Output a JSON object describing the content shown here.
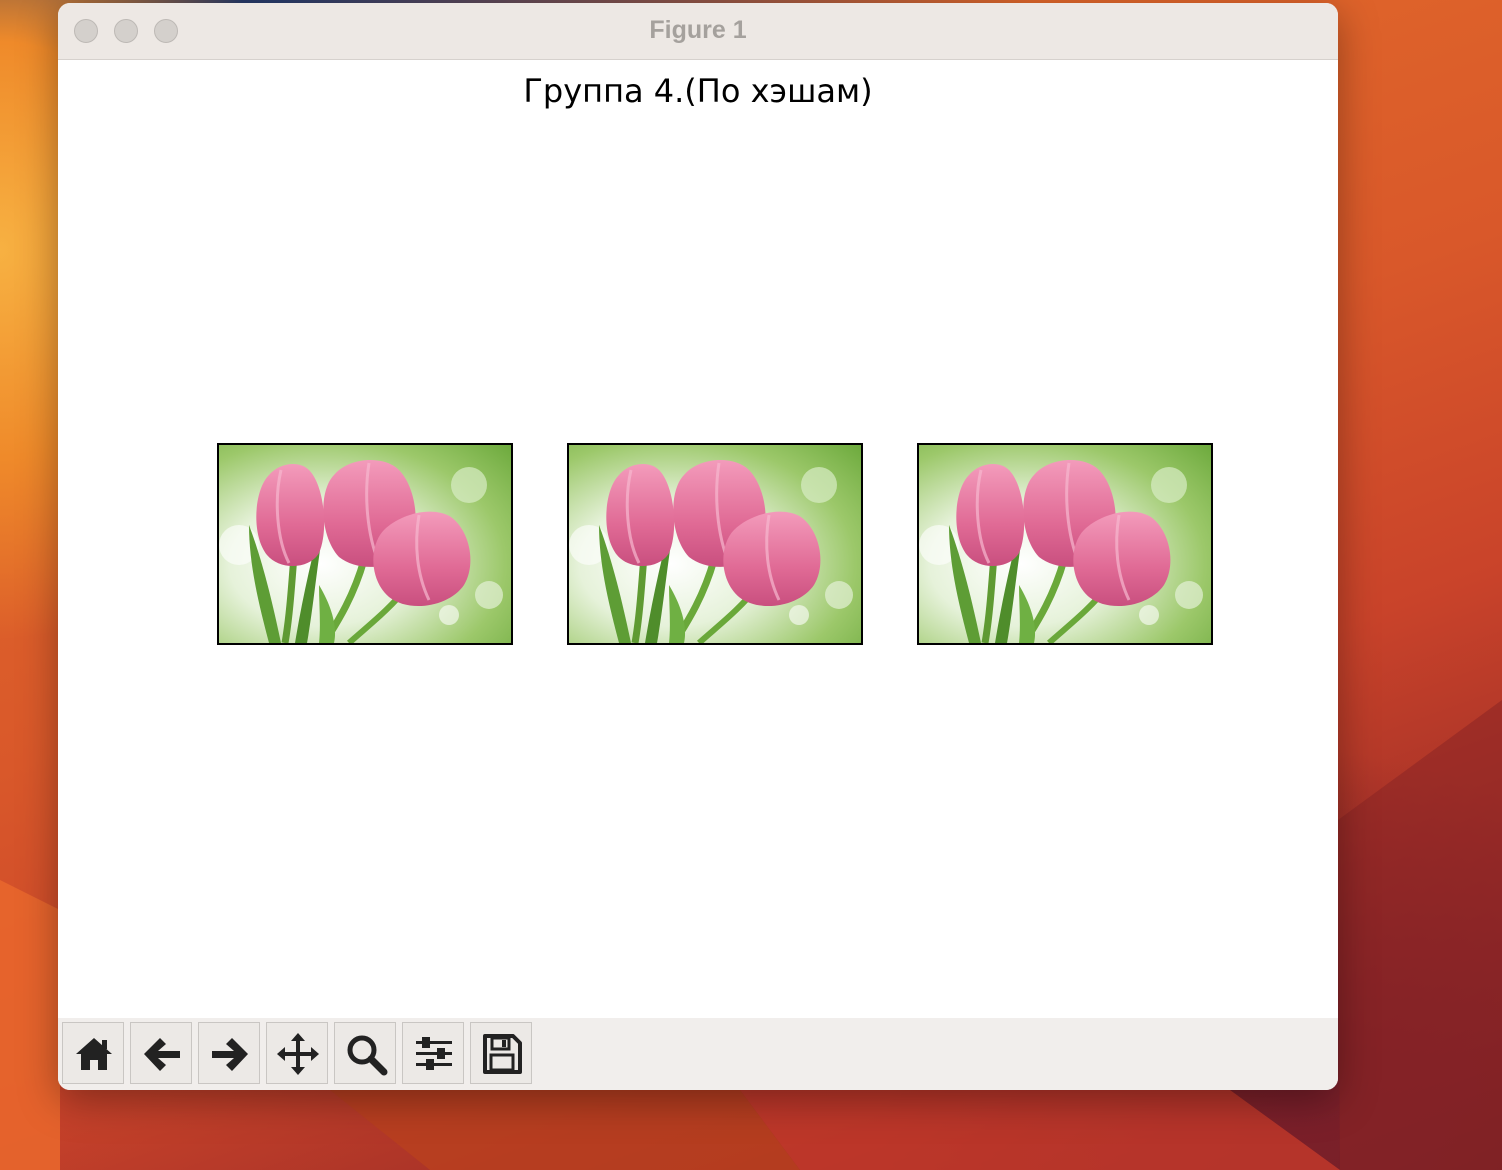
{
  "window": {
    "title": "Figure 1"
  },
  "figure": {
    "title": "Группа 4.(По хэшам)",
    "images": [
      {
        "subject": "pink-tulips-photo"
      },
      {
        "subject": "pink-tulips-photo"
      },
      {
        "subject": "pink-tulips-photo"
      }
    ]
  },
  "toolbar": {
    "buttons": [
      {
        "icon": "home-icon"
      },
      {
        "icon": "arrow-left-icon"
      },
      {
        "icon": "arrow-right-icon"
      },
      {
        "icon": "move-icon"
      },
      {
        "icon": "zoom-icon"
      },
      {
        "icon": "sliders-icon"
      },
      {
        "icon": "save-icon"
      }
    ]
  },
  "colors": {
    "titlebar": "#ede8e4",
    "toolbar": "#f1eeec",
    "tulip_pink": "#e8749c",
    "leaf_green": "#6aa83a"
  }
}
